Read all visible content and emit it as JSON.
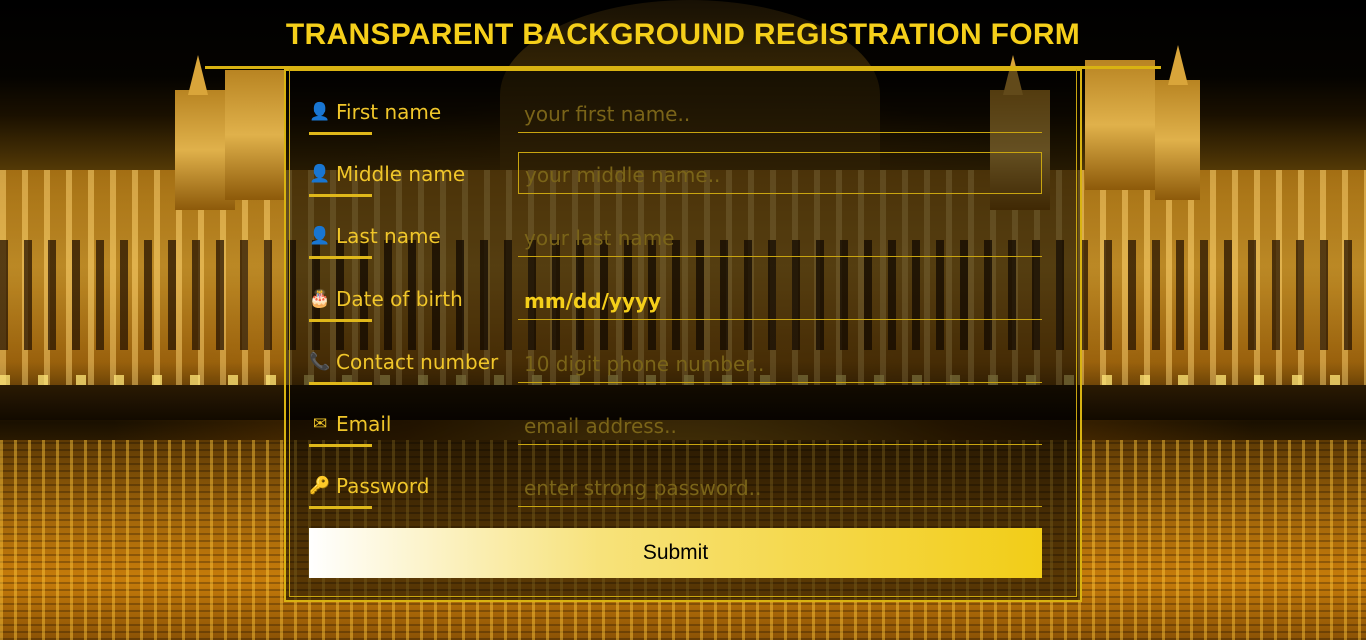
{
  "page": {
    "title": "TRANSPARENT BACKGROUND REGISTRATION FORM"
  },
  "form": {
    "fields": [
      {
        "name": "first-name",
        "label": "First name",
        "icon": "user-icon",
        "icon_glyph": "👤",
        "placeholder": "your first name..",
        "value": ""
      },
      {
        "name": "middle-name",
        "label": "Middle name",
        "icon": "user-icon",
        "icon_glyph": "👤",
        "placeholder": "your middle name..",
        "value": ""
      },
      {
        "name": "last-name",
        "label": "Last name",
        "icon": "user-icon",
        "icon_glyph": "👤",
        "placeholder": "your last name",
        "value": ""
      },
      {
        "name": "date-of-birth",
        "label": "Date of birth",
        "icon": "birthday-cake-icon",
        "icon_glyph": "🎂",
        "placeholder": "",
        "value": "mm/dd/yyyy"
      },
      {
        "name": "contact-number",
        "label": "Contact number",
        "icon": "phone-icon",
        "icon_glyph": "📞",
        "placeholder": "10 digit phone number..",
        "value": ""
      },
      {
        "name": "email",
        "label": "Email",
        "icon": "envelope-icon",
        "icon_glyph": "✉",
        "placeholder": "email address..",
        "value": ""
      },
      {
        "name": "password",
        "label": "Password",
        "icon": "key-icon",
        "icon_glyph": "🔑",
        "placeholder": "enter strong password..",
        "value": ""
      }
    ],
    "submit_label": "Submit"
  },
  "colors": {
    "accent": "#f5cf1a",
    "placeholder": "#7a6418",
    "border": "#d9b312"
  }
}
